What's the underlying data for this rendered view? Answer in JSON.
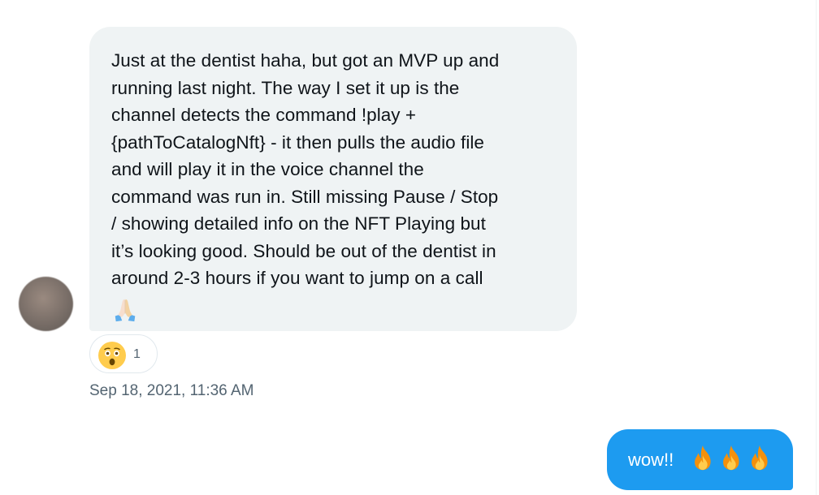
{
  "message_in": {
    "lines": [
      "Just at the dentist haha, but got an MVP up and",
      "running last night. The way I set it up is the",
      "channel detects the command !play +",
      "{pathToCatalogNft} - it then pulls the audio file",
      "and will play it in the voice channel the",
      "command was run in. Still missing Pause / Stop",
      "/ showing detailed info on the NFT Playing but",
      "it’s looking good. Should be out of the dentist in",
      "around 2-3 hours if you want to jump on a call"
    ],
    "trailing_emoji": "folded-hands-icon",
    "reaction": {
      "emoji": "astonished-face-icon",
      "count": "1"
    },
    "timestamp": "Sep 18, 2021, 11:36 AM"
  },
  "message_out": {
    "text": "wow!!",
    "emojis": [
      "fire-icon",
      "fire-icon",
      "fire-icon"
    ]
  },
  "colors": {
    "incoming_bubble": "#eff3f4",
    "outgoing_bubble": "#1d9bf0",
    "primary_text": "#0f1419",
    "secondary_text": "#536471"
  }
}
